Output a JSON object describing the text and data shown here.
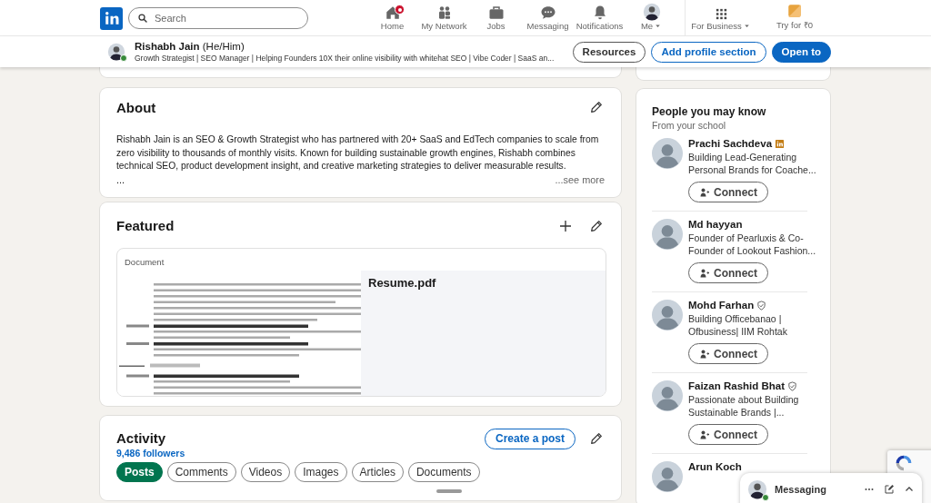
{
  "nav": {
    "search": {
      "placeholder": "Search"
    },
    "items": [
      {
        "label": "Home",
        "kind": "home",
        "notification_dot": true
      },
      {
        "label": "My Network",
        "kind": "network",
        "notification_dot": false
      },
      {
        "label": "Jobs",
        "kind": "jobs",
        "notification_dot": false
      },
      {
        "label": "Messaging",
        "kind": "messaging",
        "notification_dot": false
      },
      {
        "label": "Notifications",
        "kind": "bell",
        "notification_dot": false
      },
      {
        "label": "Me",
        "kind": "me",
        "notification_dot": false
      },
      {
        "label": "For Business",
        "kind": "business",
        "notification_dot": false
      },
      {
        "label": "Try for ₹0",
        "kind": "premium",
        "notification_dot": false
      }
    ]
  },
  "profile_bar": {
    "name": "Rishabh Jain",
    "pronouns": "(He/Him)",
    "headline": "Growth Strategist | SEO Manager | Helping Founders 10X their online visibility with whitehat SEO | Vibe Coder | SaaS an...",
    "online": true,
    "buttons": [
      {
        "label": "Resources",
        "kind": "outline"
      },
      {
        "label": "Add profile section",
        "kind": "outline-blue"
      },
      {
        "label": "Open to",
        "kind": "primary"
      }
    ]
  },
  "about": {
    "title": "About",
    "text": "Rishabh Jain is an SEO & Growth Strategist who has partnered with 20+ SaaS and EdTech companies to scale from zero visibility to thousands of monthly visits. Known for building sustainable growth engines, Rishabh combines technical SEO, product development insight, and creative marketing strategies to deliver measurable results.",
    "ellipsis": "...",
    "see_more": "...see more"
  },
  "featured": {
    "title": "Featured",
    "items": [
      {
        "type_label": "Document",
        "title": "Resume.pdf",
        "kind": "picture"
      }
    ]
  },
  "activity": {
    "title": "Activity",
    "followers": "9,486 followers",
    "create_button": "Create a post",
    "filters": [
      {
        "label": "Posts",
        "selected": true
      },
      {
        "label": "Comments",
        "selected": false
      },
      {
        "label": "Videos",
        "selected": false
      },
      {
        "label": "Images",
        "selected": false
      },
      {
        "label": "Articles",
        "selected": false
      },
      {
        "label": "Documents",
        "selected": false
      }
    ]
  },
  "people": {
    "title": "People you may know",
    "subtitle": "From your school",
    "people": [
      {
        "name": "Prachi Sachdeva",
        "premium_badge": true,
        "verified": false,
        "headline": [
          "Building Lead-Generating",
          "Personal Brands for Coache..."
        ],
        "button": "Connect"
      },
      {
        "name": "Md hayyan",
        "premium_badge": false,
        "verified": false,
        "headline": [
          "Founder of Pearluxis & Co-",
          "Founder of Lookout Fashion..."
        ],
        "button": "Connect"
      },
      {
        "name": "Mohd Farhan",
        "premium_badge": false,
        "verified": true,
        "headline": [
          "Building Officebanao |",
          "Ofbusiness| IIM Rohtak"
        ],
        "button": "Connect"
      },
      {
        "name": "Faizan Rashid Bhat",
        "premium_badge": false,
        "verified": true,
        "headline": [
          "Passionate about Building",
          "Sustainable Brands |..."
        ],
        "button": "Connect"
      },
      {
        "name": "Arun Koch",
        "premium_badge": false,
        "verified": false
      }
    ]
  },
  "messaging": {
    "title": "Messaging",
    "online": true
  }
}
